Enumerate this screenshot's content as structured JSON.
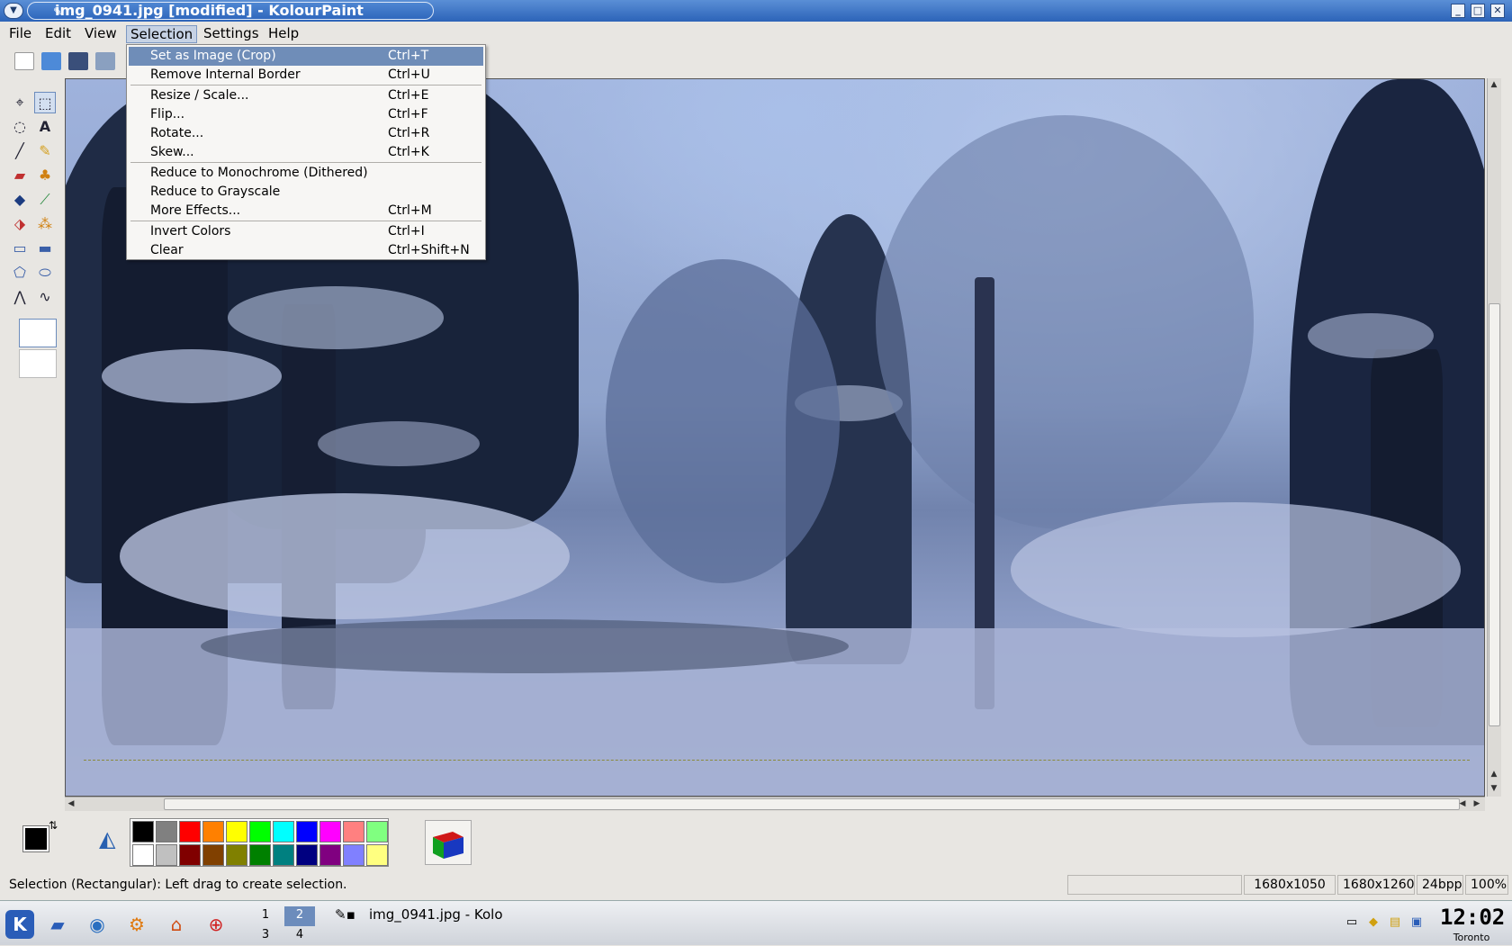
{
  "window": {
    "title": "img_0941.jpg [modified] - KolourPaint"
  },
  "menubar": [
    "File",
    "Edit",
    "View",
    "Selection",
    "Settings",
    "Help"
  ],
  "selection_menu": {
    "items": [
      {
        "label": "Set as Image (Crop)",
        "shortcut": "Ctrl+T"
      },
      {
        "label": "Remove Internal Border",
        "shortcut": "Ctrl+U"
      },
      {
        "label": "Resize / Scale...",
        "shortcut": "Ctrl+E"
      },
      {
        "label": "Flip...",
        "shortcut": "Ctrl+F"
      },
      {
        "label": "Rotate...",
        "shortcut": "Ctrl+R"
      },
      {
        "label": "Skew...",
        "shortcut": "Ctrl+K"
      },
      {
        "label": "Reduce to Monochrome (Dithered)",
        "shortcut": ""
      },
      {
        "label": "Reduce to Grayscale",
        "shortcut": ""
      },
      {
        "label": "More Effects...",
        "shortcut": "Ctrl+M"
      },
      {
        "label": "Invert Colors",
        "shortcut": "Ctrl+I"
      },
      {
        "label": "Clear",
        "shortcut": "Ctrl+Shift+N"
      }
    ]
  },
  "palette": {
    "top": [
      "#000000",
      "#808080",
      "#ff0000",
      "#ff8000",
      "#ffff00",
      "#00ff00",
      "#00ffff",
      "#0000ff",
      "#ff00ff",
      "#ff8080",
      "#80ff80"
    ],
    "bottom": [
      "#ffffff",
      "#c0c0c0",
      "#800000",
      "#804000",
      "#808000",
      "#008000",
      "#008080",
      "#000080",
      "#800080",
      "#8080ff",
      "#ffff80"
    ]
  },
  "statusbar": {
    "message": "Selection (Rectangular): Left drag to create selection.",
    "blank": "",
    "image_size": "1680x1050",
    "selection_size": "1680x1260",
    "depth": "24bpp",
    "zoom": "100%"
  },
  "taskbar": {
    "desktops": [
      "1",
      "2",
      "3",
      "4"
    ],
    "task_label": "img_0941.jpg - Kolo",
    "clock": "12:02",
    "city": "Toronto"
  }
}
